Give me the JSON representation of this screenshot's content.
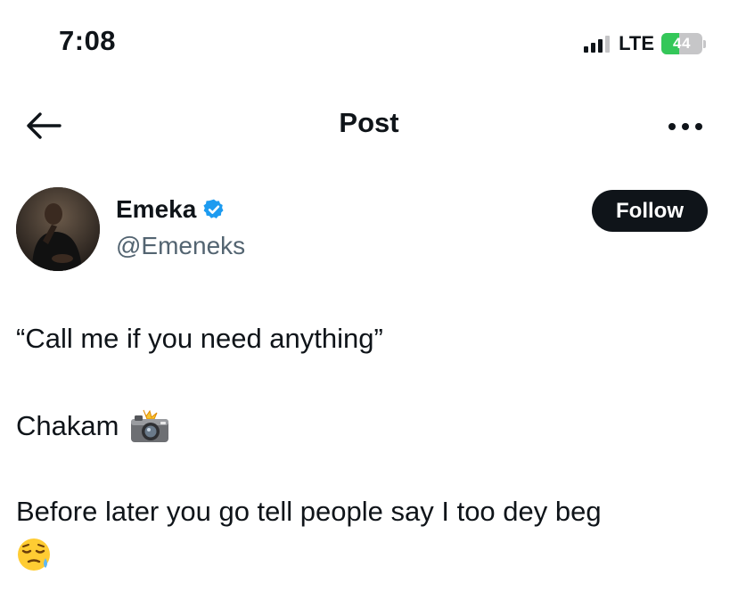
{
  "status_bar": {
    "time": "7:08",
    "network": "LTE",
    "battery_level": "44",
    "battery_fraction": 0.44,
    "signal_bars_active": 3,
    "signal_bars_total": 4
  },
  "nav": {
    "title": "Post",
    "back_icon": "arrow-left-icon",
    "more_icon": "more-horizontal-icon"
  },
  "author": {
    "name": "Emeka",
    "handle": "@Emeneks",
    "verified": true,
    "verified_color": "#1d9bf0"
  },
  "follow_button": {
    "label": "Follow"
  },
  "tweet": {
    "line1": "“Call me if you need anything”",
    "line2": "Chakam",
    "line2_emoji": "camera-with-flash-icon",
    "line3": "Before later you go tell people say I too dey beg",
    "line3_emoji": "sleepy-face-icon"
  },
  "colors": {
    "text_primary": "#0f1419",
    "text_secondary": "#536471",
    "battery_green": "#34c759",
    "button_bg": "#0f1419"
  }
}
